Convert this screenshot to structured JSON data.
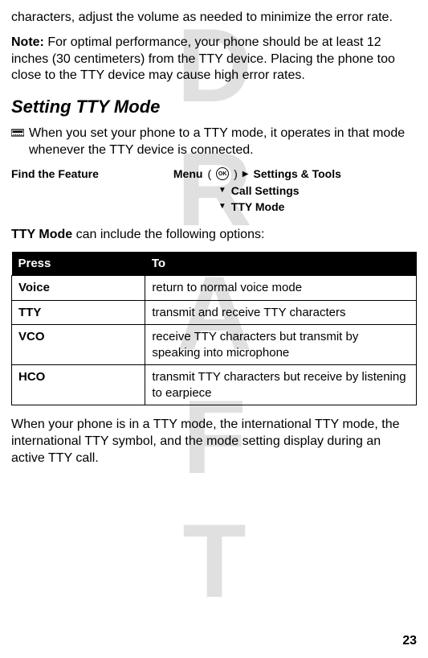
{
  "watermark": "DRAFT",
  "intro_fragment": "characters, adjust the volume as needed to minimize the error rate.",
  "note": {
    "label": "Note:",
    "text": " For optimal performance, your phone should be at least 12 inches (30 centimeters) from the TTY device. Placing the phone too close to the TTY device may cause high error rates."
  },
  "section_heading": "Setting TTY Mode",
  "tty_intro": " When you set your phone to a TTY mode, it operates in that mode whenever the TTY device is connected.",
  "feature": {
    "label": "Find the Feature",
    "menu": "Menu",
    "ok": "OK",
    "path1": "Settings & Tools",
    "path2": "Call Settings",
    "path3": "TTY Mode"
  },
  "options_intro_prefix": "TTY Mode",
  "options_intro_rest": " can include the following options:",
  "table": {
    "head_press": "Press",
    "head_to": "To",
    "rows": [
      {
        "press": "Voice",
        "to": "return to normal voice mode"
      },
      {
        "press": "TTY",
        "to": "transmit and receive TTY characters"
      },
      {
        "press": "VCO",
        "to": "receive TTY characters but transmit by speaking into microphone"
      },
      {
        "press": "HCO",
        "to": "transmit TTY characters but receive by listening to earpiece"
      }
    ]
  },
  "closing": "When your phone is in a TTY mode, the international TTY mode, the international TTY symbol, and the mode setting display during an active TTY call.",
  "page_number": "23"
}
